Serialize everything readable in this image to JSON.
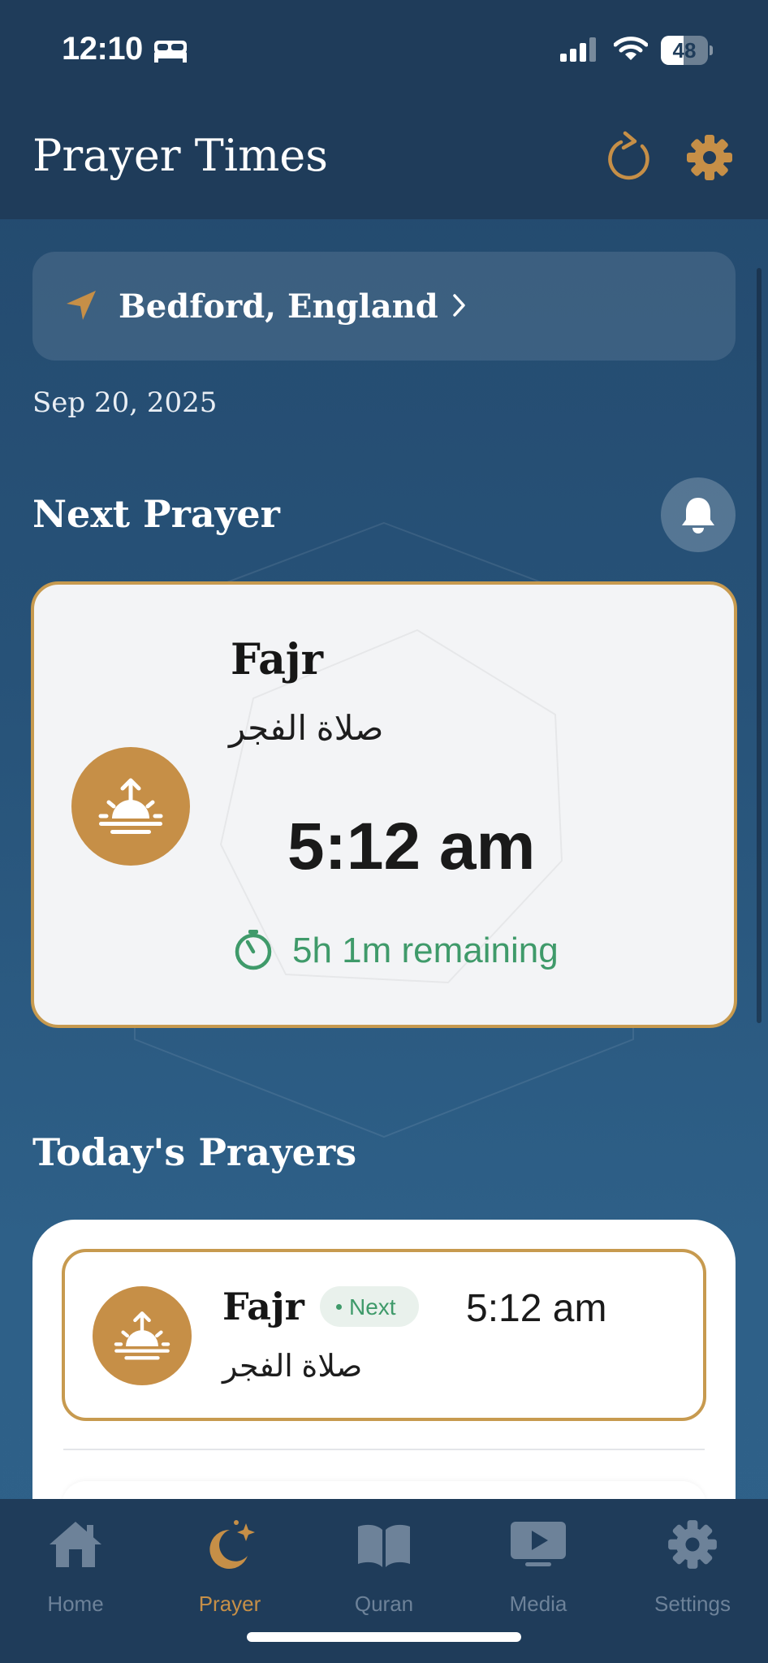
{
  "status_bar": {
    "time": "12:10",
    "battery": "48",
    "battery_level": 0.48,
    "icons": [
      "bed-icon",
      "signal-icon",
      "wifi-icon",
      "battery-icon"
    ]
  },
  "header": {
    "title": "Prayer Times",
    "actions": [
      "refresh-icon",
      "gear-icon"
    ]
  },
  "location": {
    "label": "Bedford, England",
    "icon": "location-arrow-icon"
  },
  "date": "Sep 20, 2025",
  "next_prayer": {
    "heading": "Next Prayer",
    "name": "Fajr",
    "arabic": "صلاة الفجر",
    "time": "5:12 am",
    "remaining": "5h 1m remaining",
    "icon": "sunrise-icon"
  },
  "todays_prayers": {
    "heading": "Today's Prayers",
    "rows": [
      {
        "name": "Fajr",
        "badge": "Next",
        "time": "5:12 am",
        "arabic": "صلاة الفجر",
        "icon": "sunrise-icon"
      }
    ]
  },
  "tab_bar": {
    "tabs": [
      {
        "label": "Home",
        "icon": "home-icon",
        "active": false
      },
      {
        "label": "Prayer",
        "icon": "moon-star-icon",
        "active": true
      },
      {
        "label": "Quran",
        "icon": "book-icon",
        "active": false
      },
      {
        "label": "Media",
        "icon": "play-icon",
        "active": false
      },
      {
        "label": "Settings",
        "icon": "gear-icon",
        "active": false
      }
    ]
  },
  "colors": {
    "accent": "#c68f47",
    "header": "#1f3c5a",
    "success": "#3f9a6a",
    "background": "#275278"
  }
}
